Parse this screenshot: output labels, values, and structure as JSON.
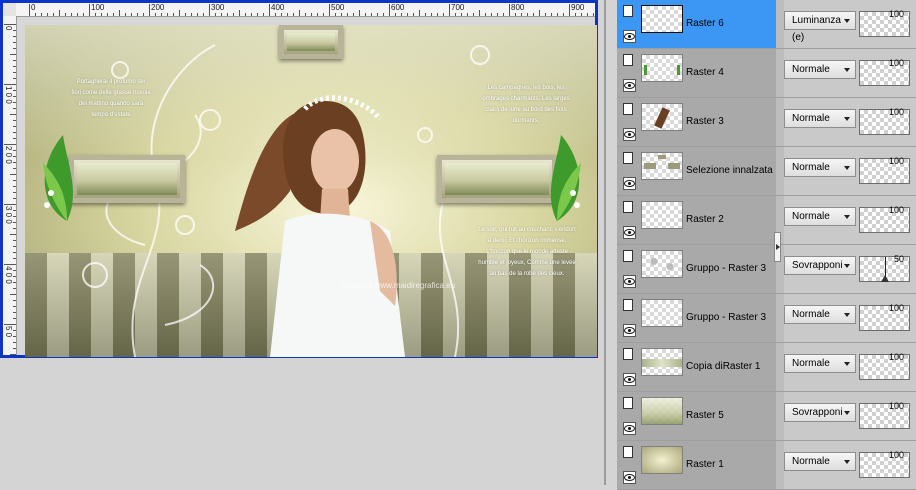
{
  "canvas": {
    "ruler_top_numbers": [
      "0",
      "100",
      "200",
      "300",
      "400",
      "500",
      "600",
      "700",
      "800",
      "900"
    ],
    "ruler_left_numbers": [
      "0",
      "1 0 0",
      "2 0 0",
      "3 0 0",
      "4 0 0",
      "5 0"
    ],
    "artwork": {
      "text_left": "Portagherai il profumo dei fiori come delle grasse nuvole del mattino quando sarà tempo d'estate",
      "text_right_top": "Les campagnes, les bois, les ombrages charmants, Les larges clairs de lune au bord des flots dormants,",
      "text_right_bottom": "Le soir, qui fuit au couchant, s'endort à demi, Et l'horizon immense, L'horizon que le monde atteste humble et joyeux, Comme une levée au bas de la robe des cieux.",
      "watermark": "pinuccia www.maidiregrafica.eu"
    }
  },
  "layers": [
    {
      "name": "Raster 6",
      "blend": "Luminanza (e)",
      "opacity": "100",
      "selected": true,
      "thumb": "blank"
    },
    {
      "name": "Raster 4",
      "blend": "Normale",
      "opacity": "100",
      "selected": false,
      "thumb": "leaves"
    },
    {
      "name": "Raster 3",
      "blend": "Normale",
      "opacity": "100",
      "selected": false,
      "thumb": "figure"
    },
    {
      "name": "Selezione innalzata",
      "blend": "Normale",
      "opacity": "100",
      "selected": false,
      "thumb": "frames"
    },
    {
      "name": "Raster 2",
      "blend": "Normale",
      "opacity": "100",
      "selected": false,
      "thumb": "blank"
    },
    {
      "name": "Gruppo - Raster 3",
      "blend": "Sovrapponi",
      "opacity": "50",
      "selected": false,
      "thumb": "flowers"
    },
    {
      "name": "Gruppo - Raster 3",
      "blend": "Normale",
      "opacity": "100",
      "selected": false,
      "thumb": "blank"
    },
    {
      "name": "Copia diRaster 1",
      "blend": "Normale",
      "opacity": "100",
      "selected": false,
      "thumb": "strip"
    },
    {
      "name": "Raster 5",
      "blend": "Sovrapponi",
      "opacity": "100",
      "selected": false,
      "thumb": "landscape"
    },
    {
      "name": "Raster 1",
      "blend": "Normale",
      "opacity": "100",
      "selected": false,
      "thumb": "background"
    }
  ],
  "colors": {
    "selected_row": "#3b97f3",
    "window_border": "#0b35c9"
  },
  "icons": {
    "layer_type": "document-icon",
    "visibility": "eye-icon",
    "dropdown": "chevron-down-icon"
  }
}
